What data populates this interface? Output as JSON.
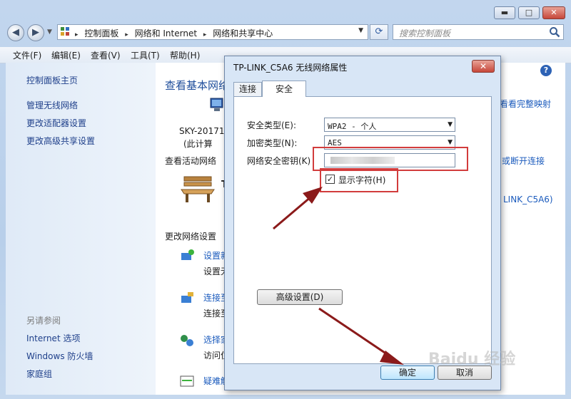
{
  "window": {
    "min_label": "▬",
    "max_label": "□",
    "close_label": "✕"
  },
  "nav": {
    "back": "◀",
    "forward": "▶"
  },
  "address": {
    "items": [
      "控制面板",
      "网络和 Internet",
      "网络和共享中心"
    ],
    "separator": "▸"
  },
  "search": {
    "placeholder": "搜索控制面板"
  },
  "menu": [
    "文件(F)",
    "编辑(E)",
    "查看(V)",
    "工具(T)",
    "帮助(H)"
  ],
  "sidebar": {
    "home": "控制面板主页",
    "items": [
      "管理无线网络",
      "更改适配器设置",
      "更改高级共享设置"
    ],
    "see_also_title": "另请参阅",
    "see_also": [
      "Internet 选项",
      "Windows 防火墙",
      "家庭组"
    ]
  },
  "main": {
    "title": "查看基本网络",
    "computer_name": "SKY-20171",
    "computer_sub": "(此计算",
    "full_map_link": "看看完整映射",
    "active_networks": "查看活动网络",
    "disconnect_link": "或断开连接",
    "network_name_initial": "T",
    "network_link": "LINK_C5A6)",
    "change_settings": "更改网络设置",
    "settings_items": [
      {
        "link": "设置新",
        "sub": "设置无"
      },
      {
        "link": "连接至",
        "sub": "连接至"
      },
      {
        "link": "选择家",
        "sub": "访问位"
      },
      {
        "link": "疑难解",
        "sub": ""
      }
    ]
  },
  "dialog": {
    "title": "TP-LINK_C5A6 无线网络属性",
    "close_label": "✕",
    "tabs": [
      "连接",
      "安全"
    ],
    "security_type_label": "安全类型(E):",
    "security_type_value": "WPA2 - 个人",
    "encryption_label": "加密类型(N):",
    "encryption_value": "AES",
    "key_label": "网络安全密钥(K)",
    "show_chars_label": "显示字符(H)",
    "show_chars_checked": true,
    "advanced_button": "高级设置(D)",
    "ok_button": "确定",
    "cancel_button": "取消"
  },
  "watermark": "Baidu 经验",
  "colors": {
    "annotation": "#d23c3c",
    "arrow": "#8b1a1a",
    "link": "#1b5bbd"
  }
}
